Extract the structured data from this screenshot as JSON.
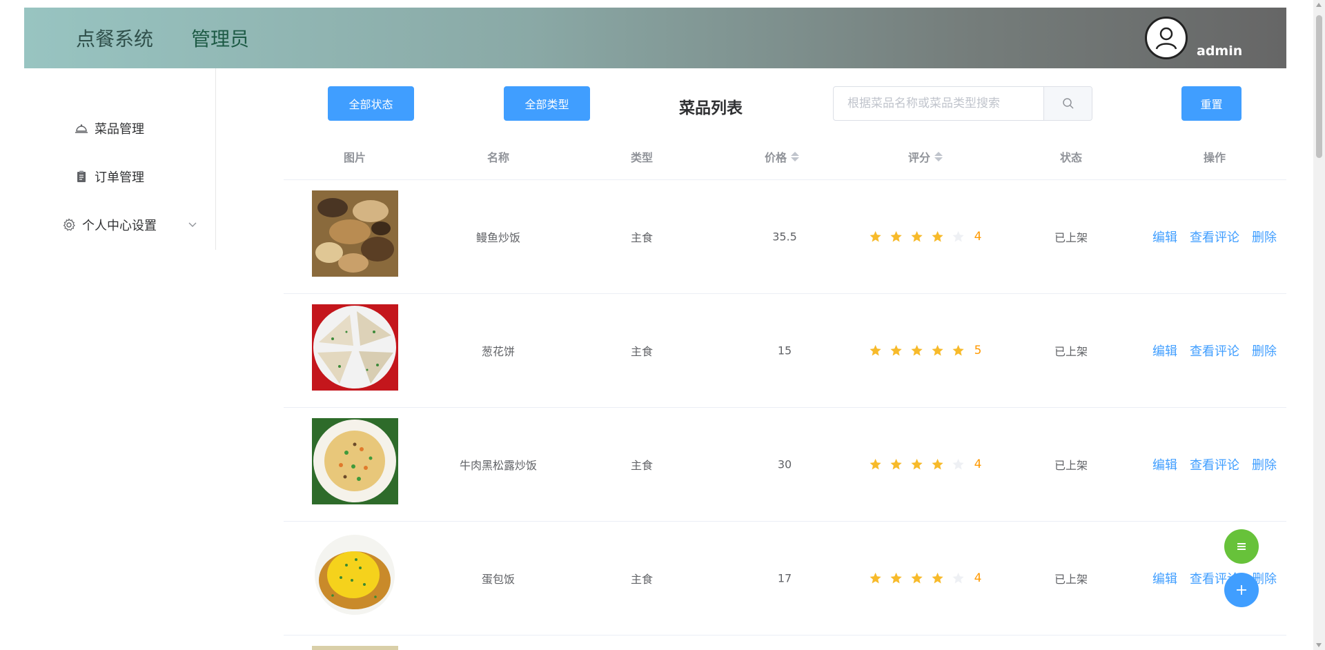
{
  "header": {
    "brand": "点餐系统",
    "role": "管理员",
    "username": "admin",
    "avatar_icon": "user-avatar-icon"
  },
  "sidebar": {
    "items": [
      {
        "label": "菜品管理",
        "icon": "cloche-icon"
      },
      {
        "label": "订单管理",
        "icon": "clipboard-icon"
      },
      {
        "label": "个人中心设置",
        "icon": "gear-icon",
        "expand_icon": "chevron-down-icon"
      }
    ]
  },
  "toolbar": {
    "status_filter": "全部状态",
    "type_filter": "全部类型",
    "title": "菜品列表",
    "search_placeholder": "根据菜品名称或菜品类型搜索",
    "search_value": "",
    "search_icon": "search-icon",
    "reset_label": "重置"
  },
  "table": {
    "columns": [
      "图片",
      "名称",
      "类型",
      "价格",
      "评分",
      "状态",
      "操作"
    ],
    "sortable": [
      "价格",
      "评分"
    ],
    "actions": [
      "编辑",
      "查看评论",
      "删除"
    ],
    "max_rating": 5,
    "rows": [
      {
        "name": "鳗鱼炒饭",
        "type": "主食",
        "price": "35.5",
        "rating": 4,
        "rating_text": "4",
        "status": "已上架",
        "image": "eel-fried-rice"
      },
      {
        "name": "葱花饼",
        "type": "主食",
        "price": "15",
        "rating": 5,
        "rating_text": "5",
        "status": "已上架",
        "image": "scallion-pancake"
      },
      {
        "name": "牛肉黑松露炒饭",
        "type": "主食",
        "price": "30",
        "rating": 4,
        "rating_text": "4",
        "status": "已上架",
        "image": "beef-truffle-fried-rice"
      },
      {
        "name": "蛋包饭",
        "type": "主食",
        "price": "17",
        "rating": 4,
        "rating_text": "4",
        "status": "已上架",
        "image": "omelette-rice"
      }
    ]
  },
  "colors": {
    "primary": "#409eff",
    "success": "#67c23a",
    "rating": "#f7ba2a",
    "rating_text": "#ff9900"
  },
  "floating": {
    "menu_icon": "list-icon",
    "add_icon": "plus-icon"
  }
}
